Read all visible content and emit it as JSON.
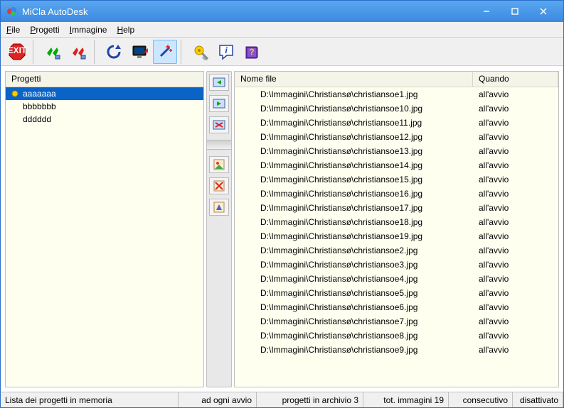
{
  "window": {
    "title": "MiCla AutoDesk"
  },
  "menu": {
    "file": "File",
    "progetti": "Progetti",
    "immagine": "Immagine",
    "help": "Help"
  },
  "sidebar": {
    "header": "Progetti",
    "items": [
      {
        "label": "aaaaaaa",
        "selected": true
      },
      {
        "label": "bbbbbbb",
        "selected": false
      },
      {
        "label": "dddddd",
        "selected": false
      }
    ]
  },
  "filelist": {
    "headers": {
      "name": "Nome file",
      "when": "Quando"
    },
    "rows": [
      {
        "name": "D:\\Immagini\\Christiansø\\christiansoe1.jpg",
        "when": "all'avvio"
      },
      {
        "name": "D:\\Immagini\\Christiansø\\christiansoe10.jpg",
        "when": "all'avvio"
      },
      {
        "name": "D:\\Immagini\\Christiansø\\christiansoe11.jpg",
        "when": "all'avvio"
      },
      {
        "name": "D:\\Immagini\\Christiansø\\christiansoe12.jpg",
        "when": "all'avvio"
      },
      {
        "name": "D:\\Immagini\\Christiansø\\christiansoe13.jpg",
        "when": "all'avvio"
      },
      {
        "name": "D:\\Immagini\\Christiansø\\christiansoe14.jpg",
        "when": "all'avvio"
      },
      {
        "name": "D:\\Immagini\\Christiansø\\christiansoe15.jpg",
        "when": "all'avvio"
      },
      {
        "name": "D:\\Immagini\\Christiansø\\christiansoe16.jpg",
        "when": "all'avvio"
      },
      {
        "name": "D:\\Immagini\\Christiansø\\christiansoe17.jpg",
        "when": "all'avvio"
      },
      {
        "name": "D:\\Immagini\\Christiansø\\christiansoe18.jpg",
        "when": "all'avvio"
      },
      {
        "name": "D:\\Immagini\\Christiansø\\christiansoe19.jpg",
        "when": "all'avvio"
      },
      {
        "name": "D:\\Immagini\\Christiansø\\christiansoe2.jpg",
        "when": "all'avvio"
      },
      {
        "name": "D:\\Immagini\\Christiansø\\christiansoe3.jpg",
        "when": "all'avvio"
      },
      {
        "name": "D:\\Immagini\\Christiansø\\christiansoe4.jpg",
        "when": "all'avvio"
      },
      {
        "name": "D:\\Immagini\\Christiansø\\christiansoe5.jpg",
        "when": "all'avvio"
      },
      {
        "name": "D:\\Immagini\\Christiansø\\christiansoe6.jpg",
        "when": "all'avvio"
      },
      {
        "name": "D:\\Immagini\\Christiansø\\christiansoe7.jpg",
        "when": "all'avvio"
      },
      {
        "name": "D:\\Immagini\\Christiansø\\christiansoe8.jpg",
        "when": "all'avvio"
      },
      {
        "name": "D:\\Immagini\\Christiansø\\christiansoe9.jpg",
        "when": "all'avvio"
      }
    ]
  },
  "status": {
    "c0": "Lista dei progetti in memoria",
    "c1": "ad ogni avvio",
    "c2": "progetti in archivio 3",
    "c3": "tot. immagini 19",
    "c4": "consecutivo",
    "c5": "disattivato"
  }
}
